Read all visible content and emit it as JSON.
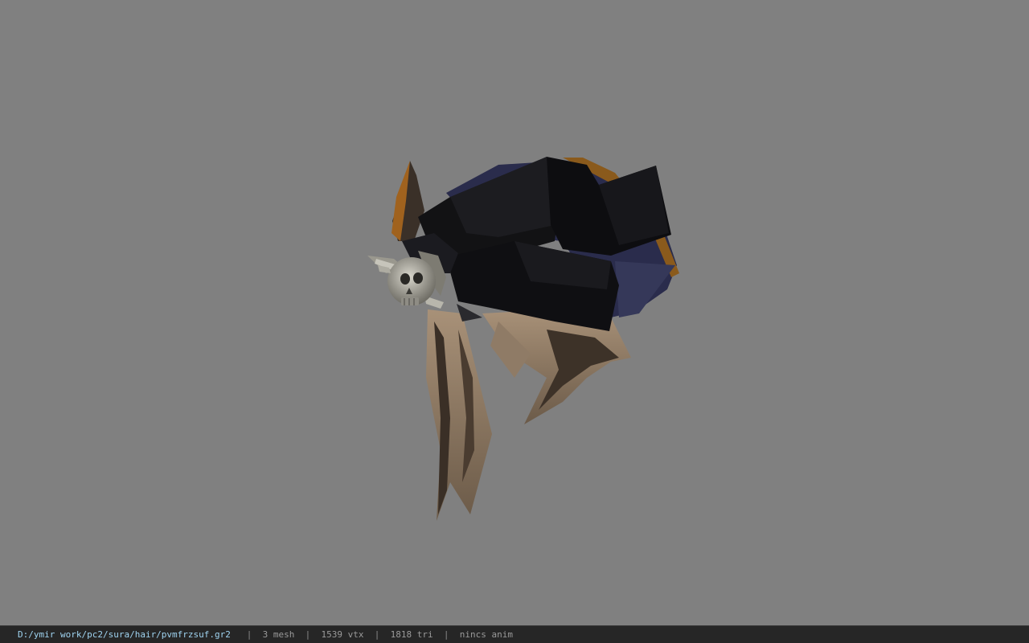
{
  "statusbar": {
    "file_path": "D:/ymir work/pc2/sura/hair/pvmfrzsuf.gr2",
    "separator": "|",
    "mesh_count": "3 mesh",
    "vertex_count": "1539 vtx",
    "triangle_count": "1818 tri",
    "anim_status": "nincs anim"
  },
  "colors": {
    "viewport_background": "#808080",
    "statusbar_background": "#262626",
    "path_text": "#9fd3f0",
    "info_text": "#9a9a9a"
  },
  "viewport": {
    "model_icon": "hair-model-3d"
  }
}
